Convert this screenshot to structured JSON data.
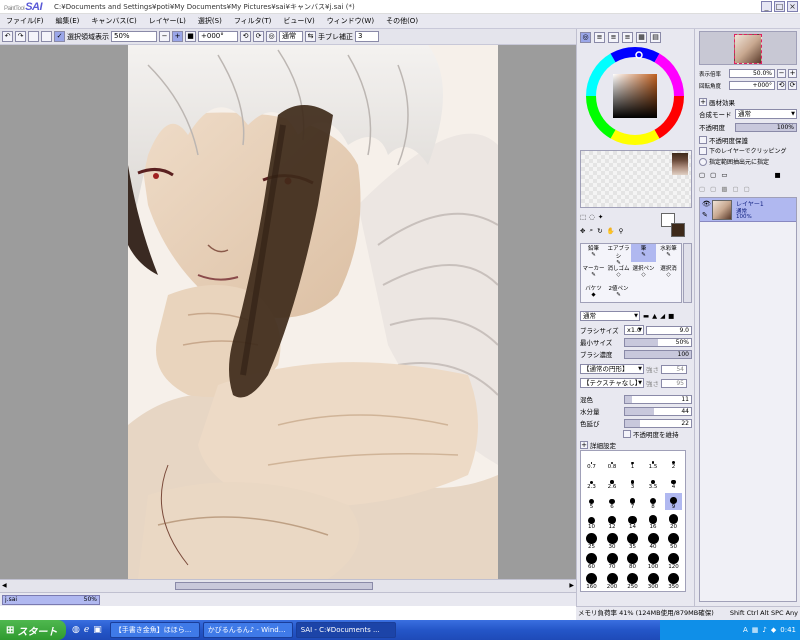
{
  "app": {
    "logo_prefix": "PaintTool",
    "logo": "SAI",
    "title_path": "C:¥Documents and Settings¥poti¥My Documents¥My Pictures¥sai¥キャンバス¥j.sai (*)"
  },
  "menu": [
    "ファイル(F)",
    "編集(E)",
    "キャンバス(C)",
    "レイヤー(L)",
    "選択(S)",
    "フィルタ(T)",
    "ビュー(V)",
    "ウィンドウ(W)",
    "その他(O)"
  ],
  "toolbar": {
    "selection_display": "選択領域表示",
    "zoom": "50%",
    "rotation": "+000°",
    "mode": "通常",
    "stabilizer_label": "手ブレ補正",
    "stabilizer_value": "3"
  },
  "navigator": {
    "zoom_label": "表示倍率",
    "zoom_value": "50.0%",
    "angle_label": "回転角度",
    "angle_value": "+000°"
  },
  "layer_effects": {
    "header": "画材効果",
    "blend_label": "合成モード",
    "blend_value": "通常",
    "opacity_label": "不透明度",
    "opacity_value": "100%",
    "opacity_fraction": 1.0,
    "protect_opacity": "不透明度保護",
    "clip_lower": "下のレイヤーでクリッピング",
    "selection_source": "指定範囲抽出元に指定"
  },
  "layers": [
    {
      "name": "レイヤー1",
      "mode": "通常",
      "opacity": "100%"
    }
  ],
  "tools": {
    "rows": [
      [
        "鉛筆",
        "エアブラシ",
        "筆",
        "水彩筆"
      ],
      [
        "マーカー",
        "消しゴム",
        "選択ペン",
        "選択消"
      ],
      [
        "バケツ",
        "2値ペン"
      ]
    ],
    "blend_mode": "通常",
    "brush_size_label": "ブラシサイズ",
    "brush_size_multiplier": "x1.0",
    "brush_size_value": "9.0",
    "min_size_label": "最小サイズ",
    "min_size_value": "50%",
    "min_size_fraction": 0.5,
    "density_label": "ブラシ濃度",
    "density_value": "100",
    "density_fraction": 1.0,
    "shape_select": "【通常の円形】",
    "shape_strength": "強さ",
    "shape_strength_value": "54",
    "texture_select": "【テクスチャなし】",
    "texture_strength": "強さ",
    "texture_strength_value": "95",
    "mix_label": "混色",
    "mix_value": "11",
    "mix_fraction": 0.11,
    "water_label": "水分量",
    "water_value": "44",
    "water_fraction": 0.44,
    "persistence_label": "色延び",
    "persistence_value": "22",
    "persistence_fraction": 0.22,
    "keep_opacity": "不透明度を維持",
    "detail_header": "詳細設定"
  },
  "brush_sizes": [
    "0.7",
    "0.8",
    "1",
    "1.5",
    "2",
    "2.3",
    "2.6",
    "3",
    "3.5",
    "4",
    "5",
    "6",
    "7",
    "8",
    "9",
    "10",
    "12",
    "14",
    "16",
    "20",
    "25",
    "30",
    "35",
    "40",
    "50",
    "60",
    "70",
    "80",
    "100",
    "120",
    "160",
    "200",
    "250",
    "300",
    "350"
  ],
  "file": {
    "name": "j.sai",
    "zoom": "50%"
  },
  "status": {
    "memory": "メモリ負荷率 41% (124MB使用/879MB確保)",
    "keys": [
      "Shift",
      "Ctrl",
      "Alt",
      "SPC",
      "Any"
    ]
  },
  "taskbar": {
    "start": "スタート",
    "items": [
      "【手書き金魚】ほほら...",
      "かびるんるん♪ - Wind...",
      "SAI - C:¥Documents ..."
    ],
    "clock": "0:41"
  },
  "colors": {
    "accent": "#5a5ad6",
    "selected": "#b0b8f0",
    "taskbar": "#2456c8",
    "start": "#2f9a2f",
    "brown_stroke": "#3e2a1a",
    "skin": "#e8d2bc"
  }
}
